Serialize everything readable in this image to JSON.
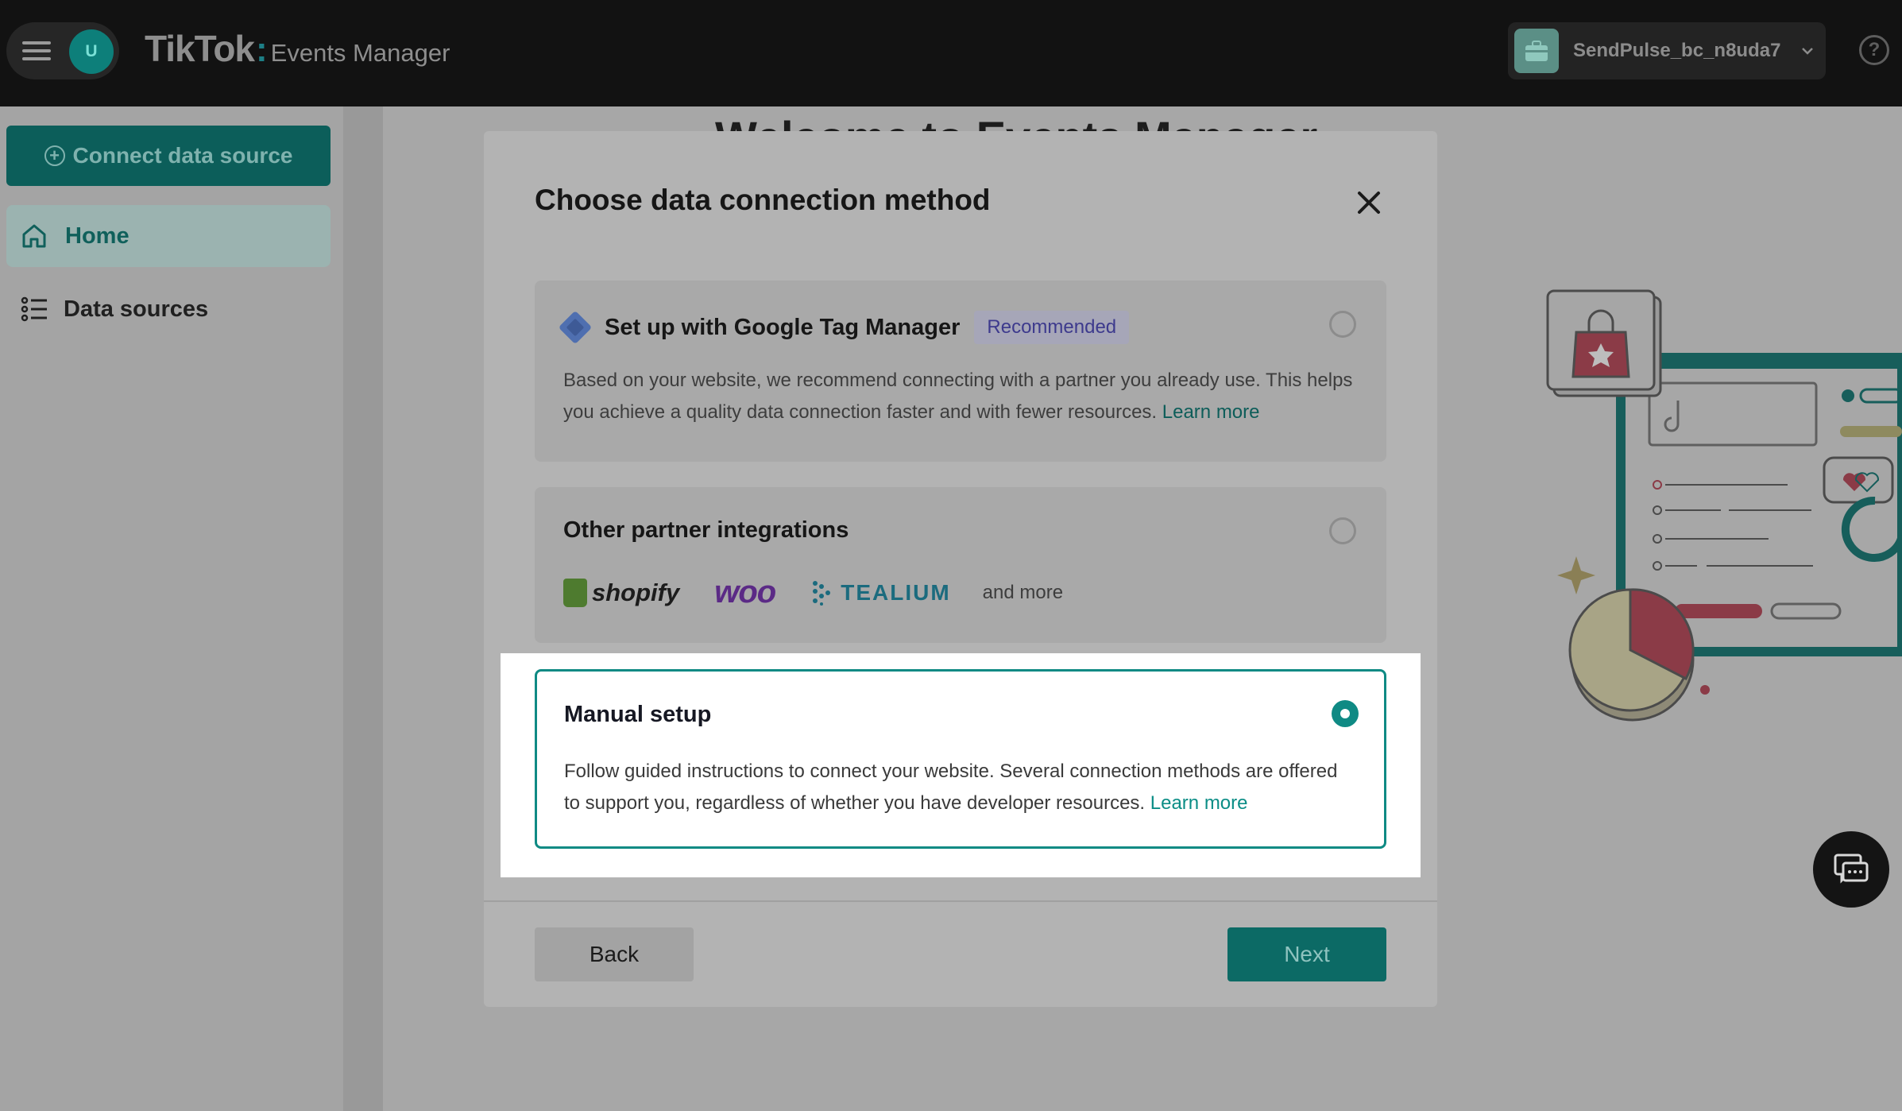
{
  "topbar": {
    "avatar_initial": "U",
    "brand_logo": "TikTok",
    "brand_product": "Events Manager",
    "account_name": "SendPulse_bc_n8uda7",
    "help_icon": "question-circle-icon"
  },
  "sidebar": {
    "connect_label": "Connect data source",
    "items": [
      {
        "label": "Home",
        "icon": "home-icon",
        "active": true
      },
      {
        "label": "Data sources",
        "icon": "list-icon",
        "active": false
      }
    ]
  },
  "background": {
    "title": "Welcome to Events Manager"
  },
  "modal": {
    "title": "Choose data connection method",
    "options": [
      {
        "title": "Set up with Google Tag Manager",
        "badge": "Recommended",
        "description": "Based on your website, we recommend connecting with a partner you already use. This helps you achieve a quality data connection faster and with fewer resources.",
        "link": "Learn more",
        "selected": false
      },
      {
        "title": "Other partner integrations",
        "partners": [
          "shopify",
          "woo",
          "TEALIUM"
        ],
        "more": "and more",
        "selected": false
      },
      {
        "title": "Manual setup",
        "description": "Follow guided instructions to connect your website. Several connection methods are offered to support you, regardless of whether you have developer resources.",
        "link": "Learn more",
        "selected": true
      }
    ],
    "back_label": "Back",
    "next_label": "Next"
  },
  "colors": {
    "accent": "#0f8a84",
    "recommended_text": "#3d3a8d"
  }
}
